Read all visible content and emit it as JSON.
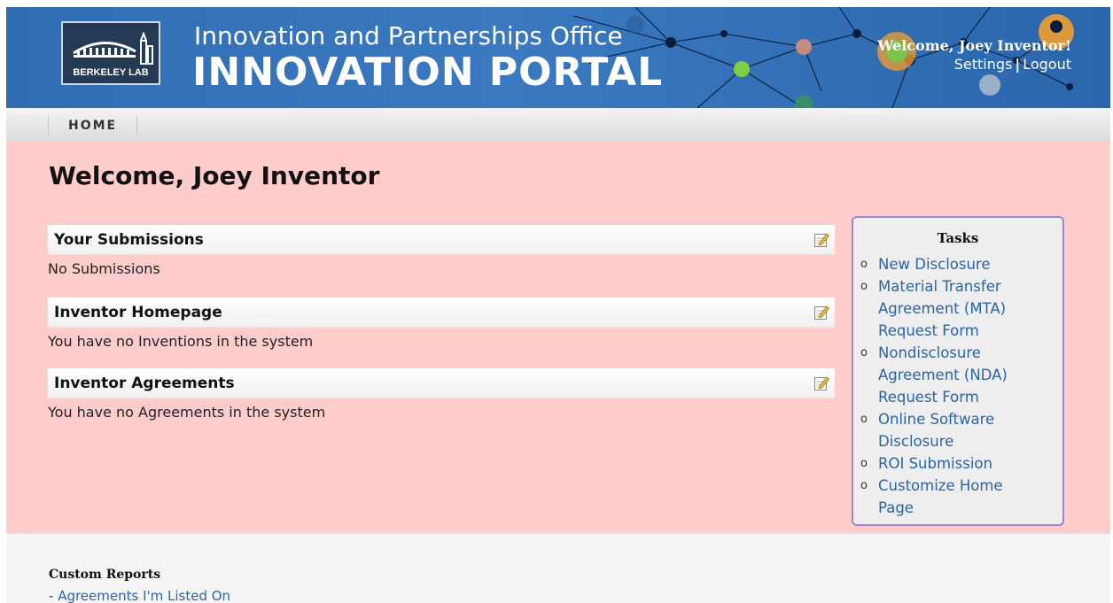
{
  "header": {
    "logo_text": "BERKELEY LAB",
    "subtitle": "Innovation and Partnerships Office",
    "title": "INNOVATION PORTAL",
    "welcome": "Welcome, Joey Inventor!",
    "settings_link": "Settings",
    "separator": "|",
    "logout_link": "Logout"
  },
  "nav": {
    "items": [
      {
        "label": "HOME"
      }
    ]
  },
  "main": {
    "page_title": "Welcome, Joey Inventor",
    "sections": [
      {
        "title": "Your Submissions",
        "body": "No Submissions"
      },
      {
        "title": "Inventor Homepage",
        "body": "You have no Inventions in the system"
      },
      {
        "title": "Inventor Agreements",
        "body": "You have no Agreements in the system"
      }
    ]
  },
  "tasks": {
    "title": "Tasks",
    "bullet": "o",
    "items": [
      {
        "label": "New Disclosure"
      },
      {
        "label": "Material Transfer Agreement (MTA) Request Form"
      },
      {
        "label": "Nondisclosure Agreement (NDA) Request Form"
      },
      {
        "label": "Online Software Disclosure"
      },
      {
        "label": "ROI Submission"
      },
      {
        "label": "Customize Home Page"
      }
    ]
  },
  "footer": {
    "reports_title": "Custom Reports",
    "reports_prefix": "- ",
    "reports": [
      {
        "label": "Agreements I'm Listed On"
      }
    ]
  },
  "colors": {
    "header_blue": "#2f6db4",
    "main_pink": "#ffcccc",
    "link_blue": "#2a64a8",
    "tasks_border": "#9b87c8"
  }
}
